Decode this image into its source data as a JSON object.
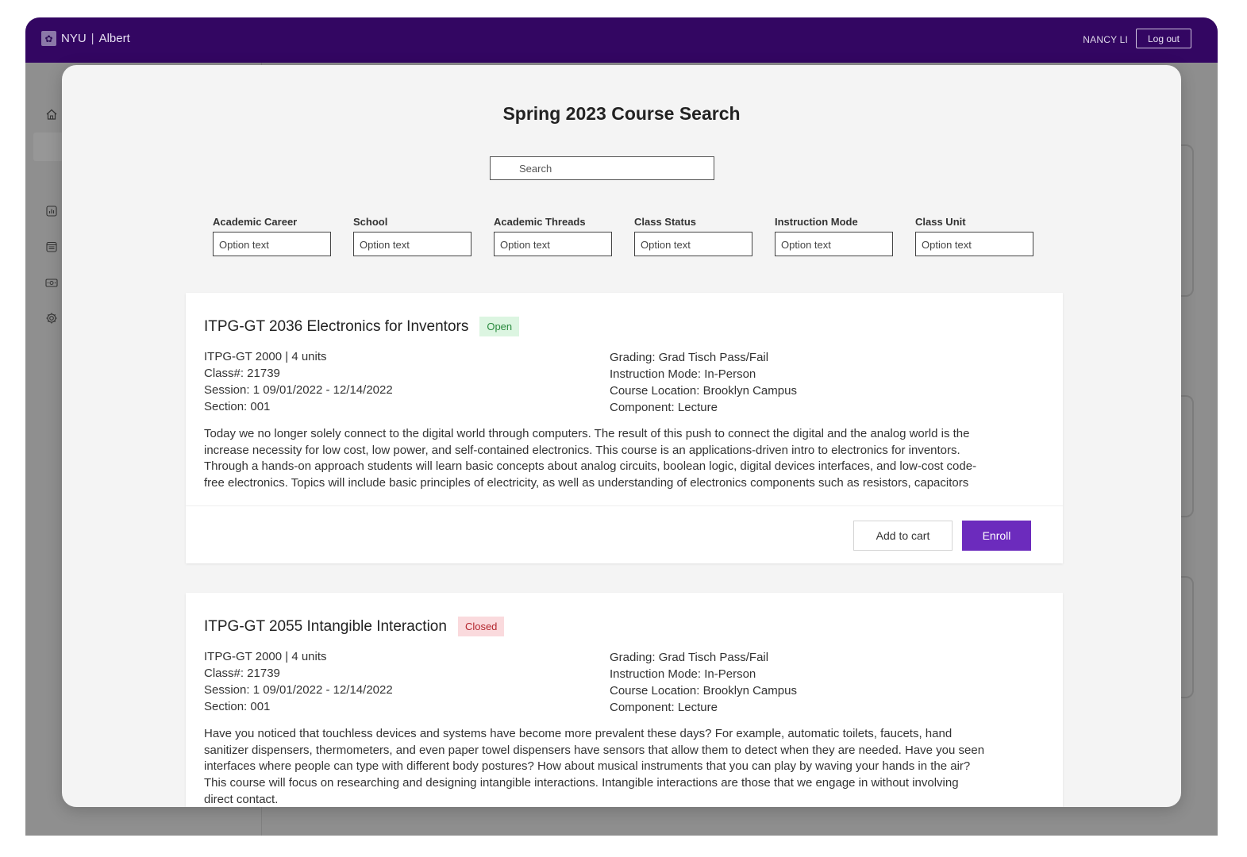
{
  "header": {
    "brand_nyu": "NYU",
    "brand_separator": "|",
    "brand_app": "Albert",
    "user_name": "NANCY LI",
    "logout_label": "Log out",
    "colors": {
      "topbar": "#330662",
      "accent": "#6c2bbd"
    }
  },
  "sidebar": {
    "icons": [
      "home-icon",
      "chart-icon",
      "calendar-icon",
      "money-icon",
      "gear-icon"
    ]
  },
  "modal": {
    "title": "Spring 2023 Course Search",
    "search_placeholder": "Search",
    "filters": [
      {
        "label": "Academic Career",
        "value": "Option text"
      },
      {
        "label": "School",
        "value": "Option text"
      },
      {
        "label": "Academic Threads",
        "value": "Option text"
      },
      {
        "label": "Class Status",
        "value": "Option text"
      },
      {
        "label": "Instruction Mode",
        "value": "Option text"
      },
      {
        "label": "Class Unit",
        "value": "Option text"
      }
    ],
    "courses": [
      {
        "title": "ITPG-GT 2036 Electronics for Inventors",
        "status": "Open",
        "course_units": "ITPG-GT 2000 | 4 units",
        "class_no": "Class#: 21739",
        "session": "Session: 1 09/01/2022 - 12/14/2022",
        "section": "Section: 001",
        "grading": "Grading: Grad Tisch Pass/Fail",
        "instruction_mode": "Instruction Mode: In-Person",
        "location": "Course Location: Brooklyn Campus",
        "component": "Component: Lecture",
        "description": "Today we no longer solely connect to the digital world through computers. The result of this push to connect the digital and the analog world is the increase necessity for low cost, low power, and self-contained electronics. This course is an applications-driven intro to electronics for inventors. Through a hands-on approach students will learn basic concepts about analog circuits, boolean logic, digital devices interfaces, and low-cost code-free electronics. Topics will include basic principles of electricity, as well as understanding of electronics components such as resistors, capacitors",
        "add_to_cart_label": "Add to cart",
        "enroll_label": "Enroll"
      },
      {
        "title": "ITPG-GT 2055 Intangible Interaction",
        "status": "Closed",
        "course_units": "ITPG-GT 2000 | 4 units",
        "class_no": "Class#: 21739",
        "session": "Session: 1 09/01/2022 - 12/14/2022",
        "section": "Section: 001",
        "grading": "Grading: Grad Tisch Pass/Fail",
        "instruction_mode": "Instruction Mode: In-Person",
        "location": "Course Location: Brooklyn Campus",
        "component": "Component: Lecture",
        "description": "Have you noticed that touchless devices and systems have become more prevalent these days? For example, automatic toilets, faucets, hand sanitizer dispensers, thermometers, and even paper towel dispensers have sensors that allow them to detect when they are needed. Have you seen interfaces where people can type with different body postures? How about musical instruments that you can play by waving your hands in the air? This course will focus on researching and designing intangible interactions. Intangible interactions are those that we engage in without involving direct contact."
      }
    ]
  }
}
